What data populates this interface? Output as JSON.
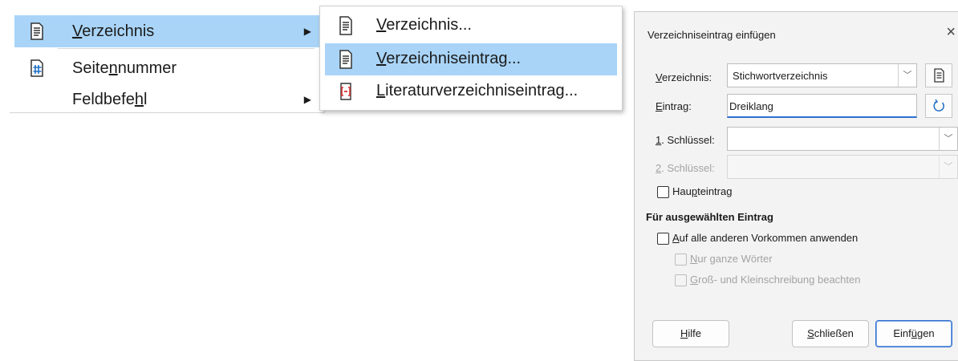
{
  "menu": {
    "items": [
      {
        "label": "Verzeichnis",
        "underline_index": 0,
        "icon": "document-index-icon",
        "has_submenu": true,
        "highlighted": true
      },
      {
        "label": "Seitennummer",
        "underline_index": 5,
        "icon": "page-number-icon",
        "has_submenu": false,
        "highlighted": false
      },
      {
        "label": "Feldbefehl",
        "underline_index": 8,
        "icon": "",
        "has_submenu": true,
        "highlighted": false
      }
    ]
  },
  "submenu": {
    "items": [
      {
        "label": "Verzeichnis...",
        "underline_index": 0,
        "icon": "document-index-icon",
        "highlighted": false
      },
      {
        "label": "Verzeichniseintrag...",
        "underline_index": 0,
        "icon": "index-entry-icon",
        "highlighted": true
      },
      {
        "label": "Literaturverzeichniseintrag...",
        "underline_index": 0,
        "icon": "bibliography-entry-icon",
        "highlighted": false
      }
    ]
  },
  "dialog": {
    "title": "Verzeichniseintrag einfügen",
    "close_glyph": "×",
    "verzeichnis": {
      "label": "Verzeichnis:",
      "underline_index": 0,
      "value": "Stichwortverzeichnis"
    },
    "eintrag": {
      "label": "Eintrag:",
      "underline_index": 0,
      "value": "Dreiklang"
    },
    "schluessel1": {
      "label": "1. Schlüssel:",
      "underline_index": 0,
      "value": ""
    },
    "schluessel2": {
      "label": "2. Schlüssel:",
      "underline_index": 0,
      "value": "",
      "disabled": true
    },
    "haupteintrag": {
      "label": "Haupteintrag",
      "underline_index": 3,
      "checked": false
    },
    "section_title": "Für ausgewählten Eintrag",
    "alle_anwenden": {
      "label": "Auf alle anderen Vorkommen anwenden",
      "underline_index": 0,
      "checked": false
    },
    "nur_ganze": {
      "label": "Nur ganze Wörter",
      "underline_index": 0,
      "checked": false,
      "disabled": true
    },
    "gross_klein": {
      "label": "Groß- und Kleinschreibung beachten",
      "underline_index": 0,
      "checked": false,
      "disabled": true
    },
    "buttons": {
      "hilfe": {
        "label": "Hilfe",
        "underline_index": 0
      },
      "schliessen": {
        "label": "Schließen",
        "underline_index": 0
      },
      "einfuegen": {
        "label": "Einfügen",
        "underline_index": 4
      }
    }
  },
  "colors": {
    "highlight": "#a9d4f7",
    "default_button_border": "#2f6fd0",
    "dialog_bg": "#f3f3f3"
  }
}
